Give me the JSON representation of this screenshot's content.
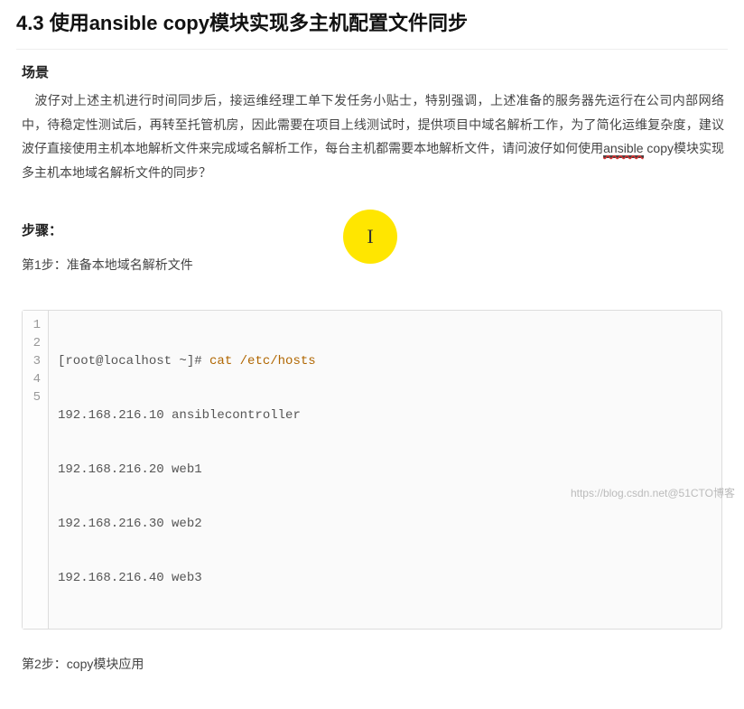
{
  "section_title": "4.3 使用ansible copy模块实现多主机配置文件同步",
  "scene": {
    "heading": "场景",
    "body_prefix": "　波仔对上述主机进行时间同步后，接运维经理工单下发任务小贴士，特别强调，上述准备的服务器先运行在公司内部网络中，待稳定性测试后，再转至托管机房，因此需要在项目上线测试时，提供项目中域名解析工作，为了简化运维复杂度，建议波仔直接使用主机本地解析文件来完成域名解析工作，每台主机都需要本地解析文件，请问波仔如何使用",
    "ansible_word": "ansible",
    "body_suffix": " copy模块实现多主机本地域名解析文件的同步？"
  },
  "steps_heading": "步骤：",
  "step1": "第1步：准备本地域名解析文件",
  "step2": "第2步：copy模块应用",
  "code": {
    "line_numbers": [
      "1",
      "2",
      "3",
      "4",
      "5"
    ],
    "prompt_host": "[root@localhost ~]# ",
    "prompt_cmd": "cat /etc/hosts",
    "lines": [
      "192.168.216.10 ansiblecontroller",
      "192.168.216.20 web1",
      "192.168.216.30 web2",
      "192.168.216.40 web3"
    ]
  },
  "cursor_glyph": "I",
  "watermark": "https://blog.csdn.net@51CTO博客"
}
